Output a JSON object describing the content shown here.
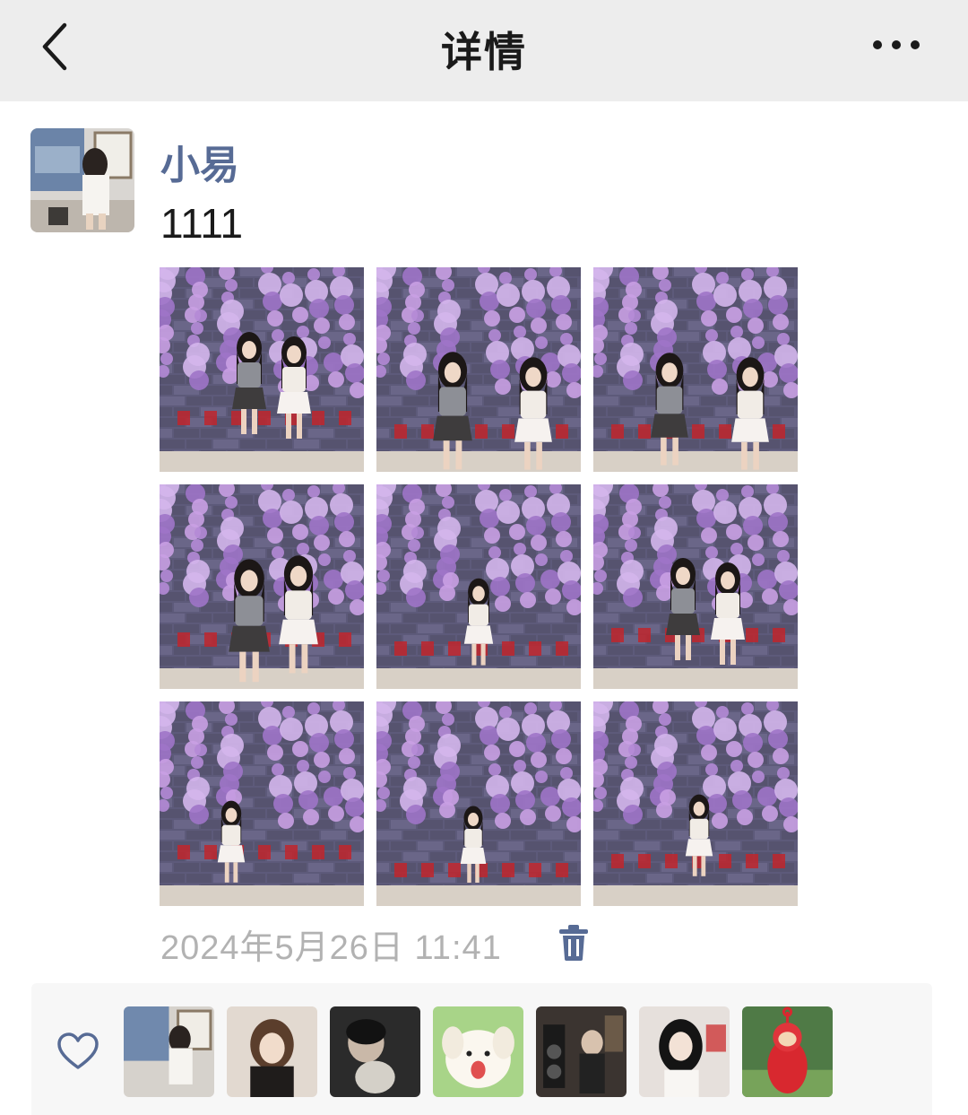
{
  "header": {
    "title": "详情",
    "back_icon": "chevron-left-icon",
    "more_icon": "more-dots-icon"
  },
  "post": {
    "author": "小易",
    "text": "1111",
    "time": "2024年5月26日 11:41",
    "delete_icon": "trash-icon",
    "photo_count": 9
  },
  "likes": {
    "icon": "heart-outline-icon",
    "count": 7
  },
  "colors": {
    "header_bg": "#ededed",
    "author_name": "#576b95",
    "timestamp": "#b2b2b2",
    "likes_bg": "#f7f7f7"
  }
}
